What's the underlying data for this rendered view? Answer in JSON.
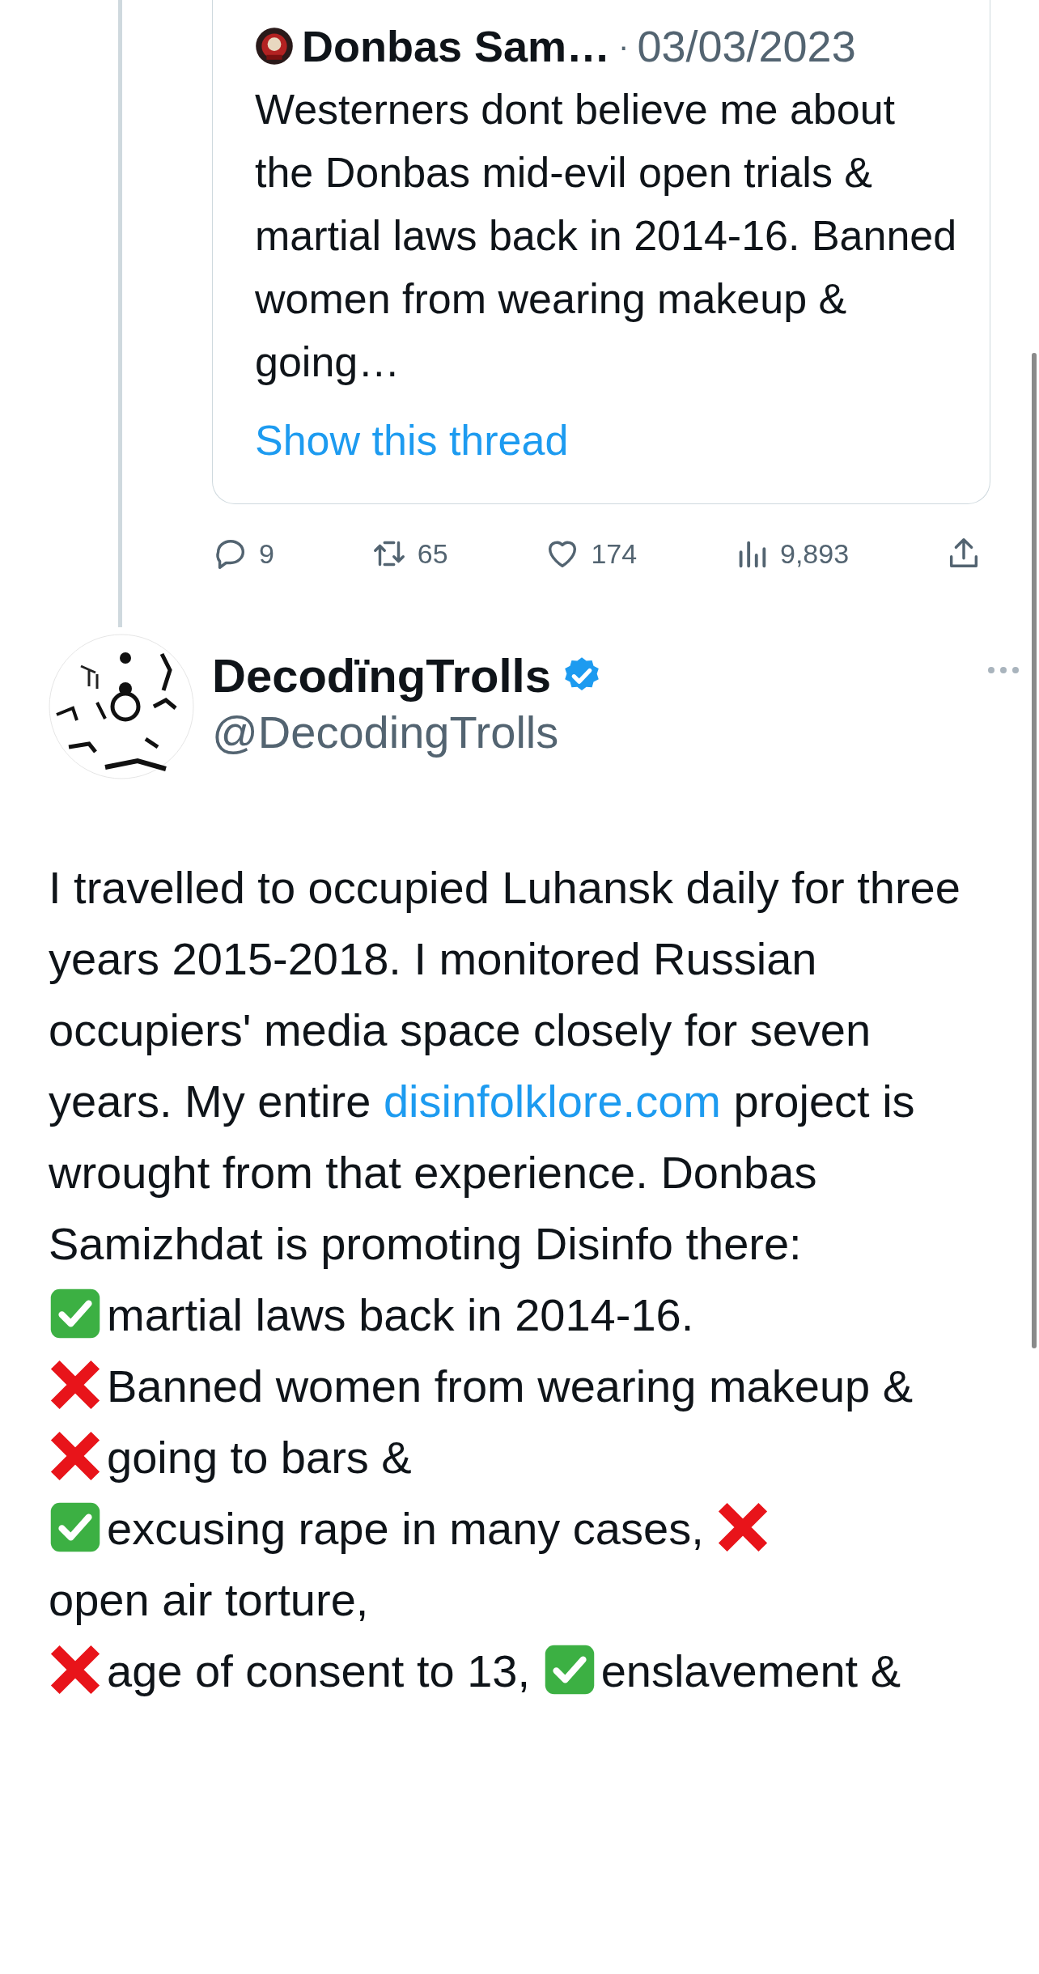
{
  "quoted_tweet": {
    "author": "Donbas Sam…",
    "separator": "·",
    "date": "03/03/2023",
    "text": "Westerners dont believe me about the Donbas mid-evil open trials & martial laws back in 2014-16. Banned women from wearing makeup & going…",
    "show_thread": "Show this thread"
  },
  "stats": {
    "replies": "9",
    "retweets": "65",
    "likes": "174",
    "views": "9,893"
  },
  "tweet": {
    "name": "DecodïngTrolls",
    "verified": true,
    "handle": "@DecodingTrolls",
    "intro": {
      "before": "I travelled to occupied Luhansk daily for three years 2015-2018. I monitored Russian occupiers' media space closely for seven years. My entire ",
      "link": "disinfolklore.com",
      "after": " project is wrought from that experience. Donbas Samizhdat is promoting Disinfo there:"
    },
    "points": [
      {
        "segments": [
          {
            "kind": "check",
            "text": "martial laws back in 2014-16."
          }
        ]
      },
      {
        "segments": [
          {
            "kind": "cross",
            "text": "Banned women from wearing makeup &"
          }
        ]
      },
      {
        "segments": [
          {
            "kind": "cross",
            "text": "going to bars &"
          }
        ]
      },
      {
        "segments": [
          {
            "kind": "check",
            "text": "excusing rape in many cases, "
          },
          {
            "kind": "cross",
            "text": "open air torture,"
          }
        ]
      },
      {
        "segments": [
          {
            "kind": "cross",
            "text": "age of consent to 13, "
          },
          {
            "kind": "check",
            "text": "enslavement &"
          }
        ]
      }
    ]
  }
}
